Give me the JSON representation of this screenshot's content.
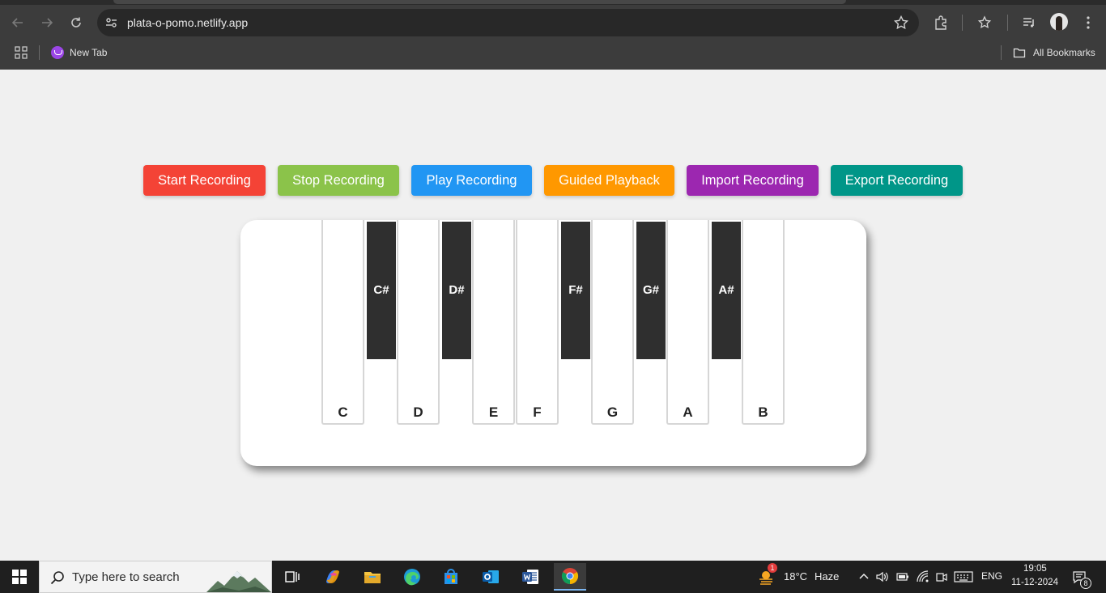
{
  "browser": {
    "url": "plata-o-pomo.netlify.app",
    "bookmarks": [
      {
        "label": "New Tab"
      }
    ],
    "all_bookmarks_label": "All Bookmarks"
  },
  "controls": {
    "buttons": [
      {
        "label": "Start Recording",
        "color": "#f44336"
      },
      {
        "label": "Stop Recording",
        "color": "#8bc34a"
      },
      {
        "label": "Play Recording",
        "color": "#2196f3"
      },
      {
        "label": "Guided Playback",
        "color": "#ff9800"
      },
      {
        "label": "Import Recording",
        "color": "#9c27b0"
      },
      {
        "label": "Export Recording",
        "color": "#009688"
      }
    ]
  },
  "piano": {
    "white_keys": [
      "C",
      "D",
      "E",
      "F",
      "G",
      "A",
      "B"
    ],
    "black_keys": [
      "C#",
      "D#",
      "F#",
      "G#",
      "A#"
    ]
  },
  "taskbar": {
    "search_placeholder": "Type here to search",
    "weather_temp": "18°C",
    "weather_desc": "Haze",
    "weather_badge": "1",
    "language": "ENG",
    "time": "19:05",
    "date": "11-12-2024",
    "notification_count": "8"
  }
}
